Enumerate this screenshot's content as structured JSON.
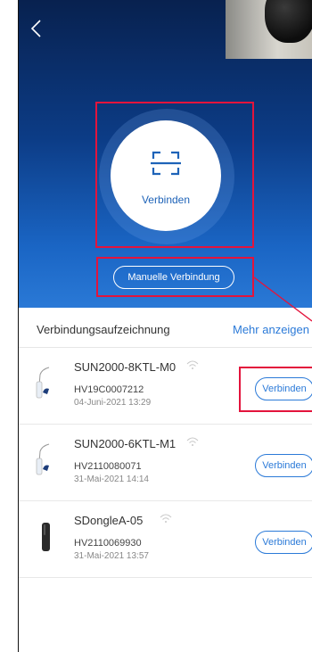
{
  "header": {
    "back_icon": "chevron-left-icon"
  },
  "connect": {
    "icon": "scan-frame-icon",
    "label": "Verbinden"
  },
  "manual_connect_label": "Manuelle Verbindung",
  "records": {
    "title": "Verbindungsaufzeichnung",
    "more_label": "Mehr anzeigen",
    "items": [
      {
        "name": "SUN2000-8KTL-M0",
        "serial": "HV19C0007212",
        "date": "04-Juni-2021 13:29",
        "connect_label": "Verbinden",
        "device_icon": "inverter-icon"
      },
      {
        "name": "SUN2000-6KTL-M1",
        "serial": "HV2110080071",
        "date": "31-Mai-2021 14:14",
        "connect_label": "Verbinden",
        "device_icon": "inverter-icon"
      },
      {
        "name": "SDongleA-05",
        "serial": "HV2110069930",
        "date": "31-Mai-2021 13:57",
        "connect_label": "Verbinden",
        "device_icon": "dongle-icon"
      }
    ]
  },
  "colors": {
    "accent": "#2b7ad8",
    "highlight": "#e3143c",
    "header_top": "#08214f",
    "header_bottom": "#2a79d6"
  }
}
